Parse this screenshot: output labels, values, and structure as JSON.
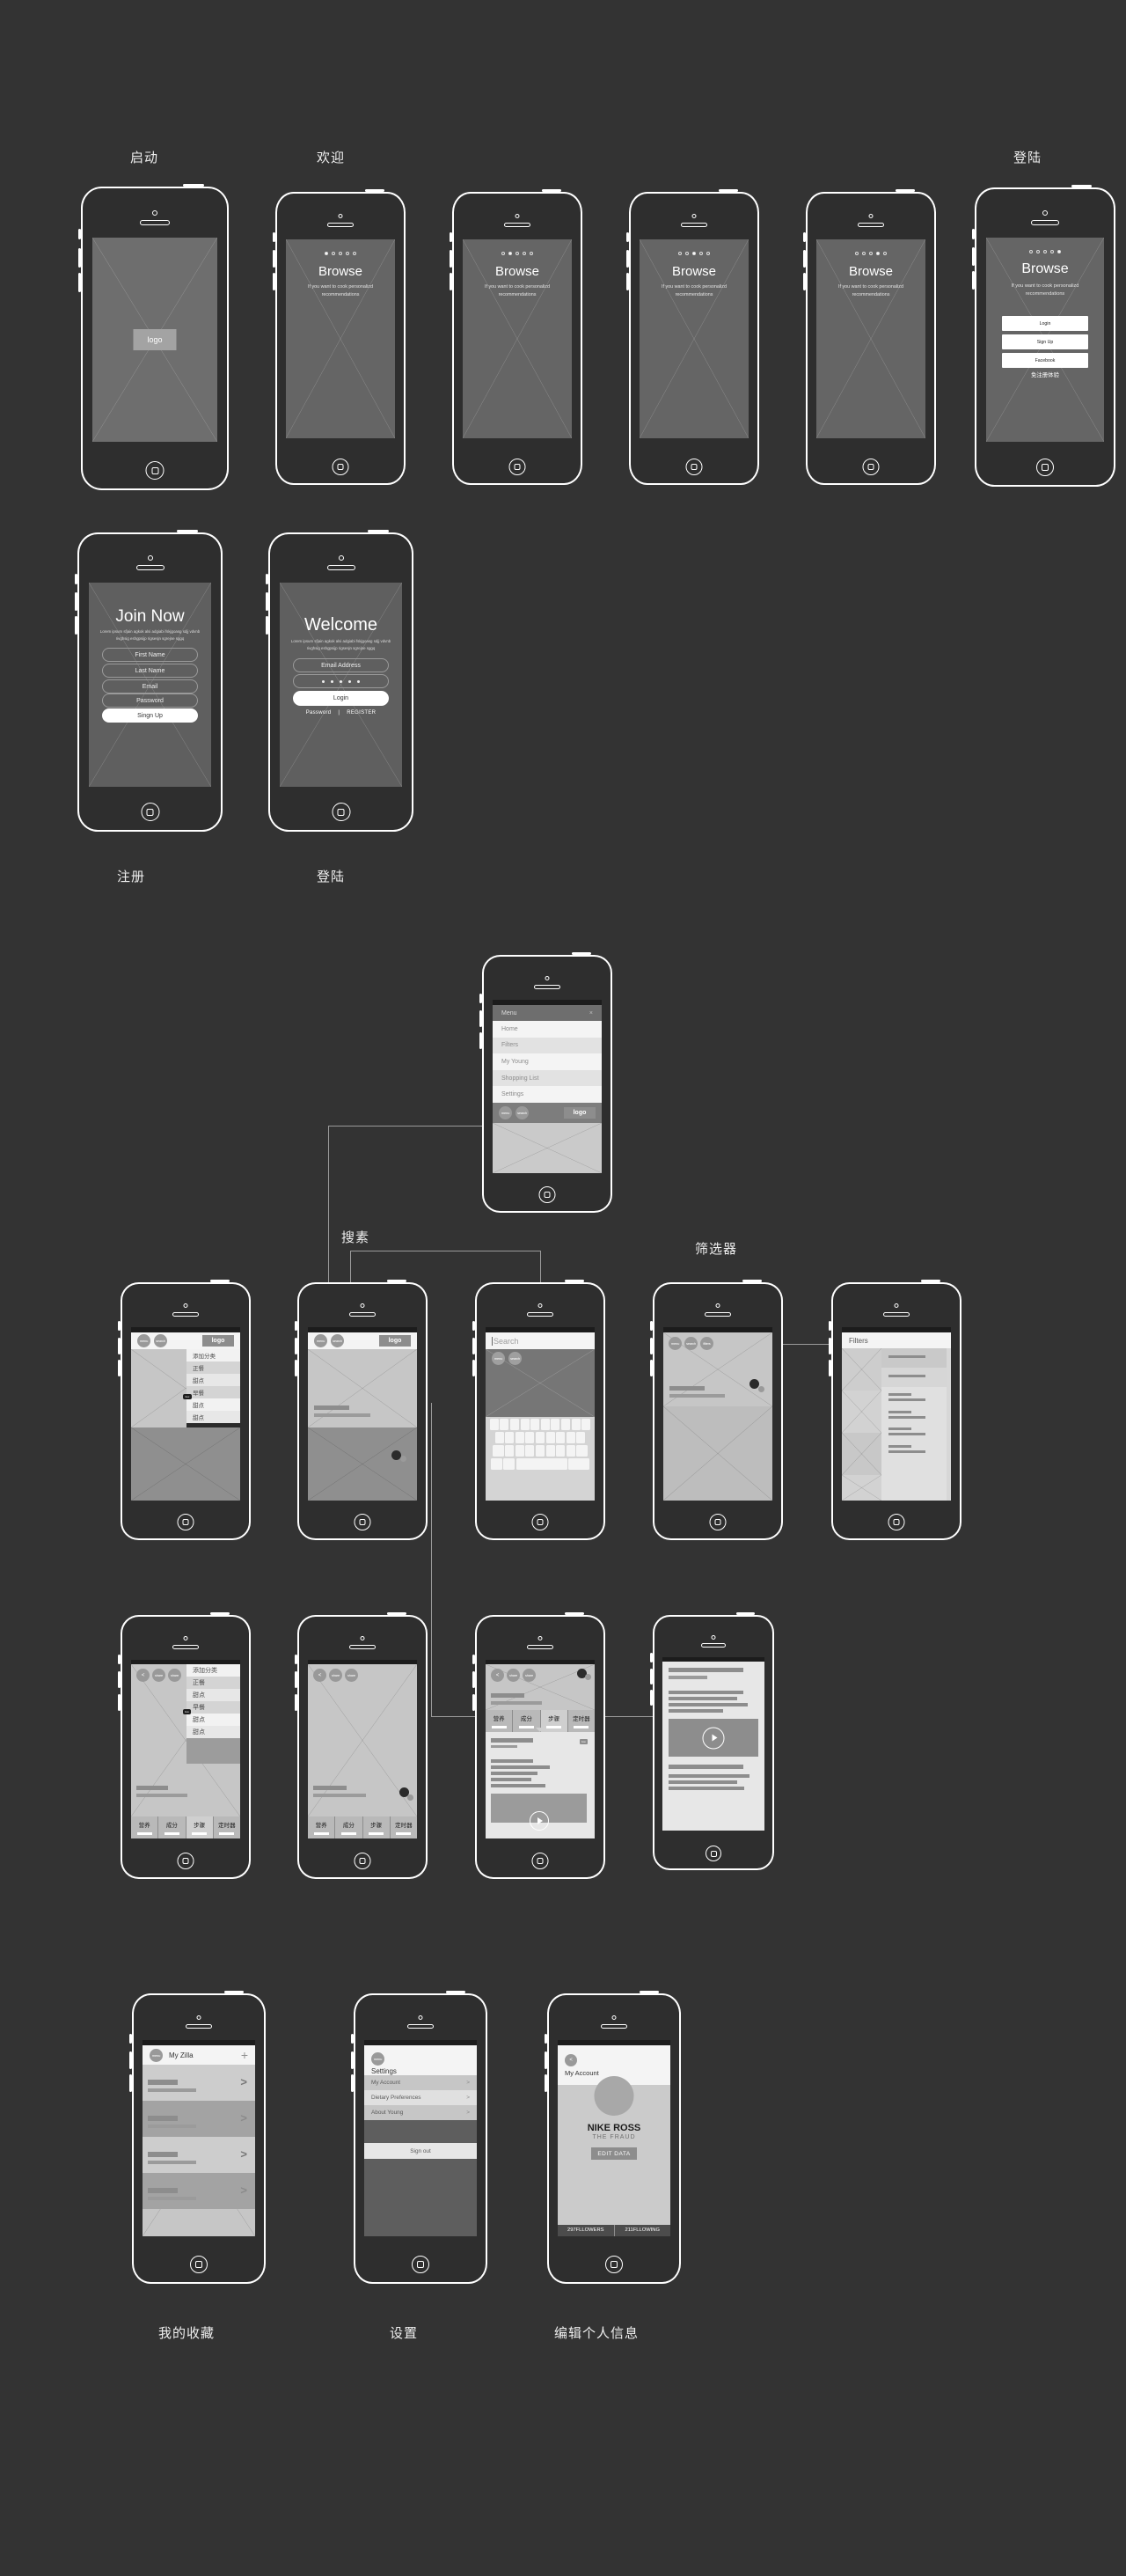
{
  "meta": {
    "bg_color": "#333333",
    "accent": "#ffffff"
  },
  "section_labels": {
    "launch": "启动",
    "welcome": "欢迎",
    "login_top": "登陆",
    "register": "注册",
    "login_bottom": "登陆",
    "search": "搜素",
    "filters": "筛选器",
    "favorites": "我的收藏",
    "settings": "设置",
    "edit_profile": "编辑个人信息"
  },
  "splash": {
    "logo_label": "logo"
  },
  "onboarding": {
    "title": "Browse",
    "subtitle": "If you want to cook personalizd recommendations",
    "dot_count": 5,
    "slides": [
      {
        "active_dot": 0
      },
      {
        "active_dot": 1
      },
      {
        "active_dot": 2
      },
      {
        "active_dot": 3
      },
      {
        "active_dot": 4
      }
    ],
    "buttons": [
      "Login",
      "Sign Up",
      "Facebook"
    ],
    "free_trial": "免注册体验"
  },
  "signup": {
    "title": "Join Now",
    "subtitle": "Lorem ipsum sfjain agkok alsi adgiabi fskjgoasg sdjj vdvnb rivghsig eshgpsijp rigsesjn sgrejne sggq",
    "fields": [
      "First Name",
      "Last Name",
      "Email",
      "Password"
    ],
    "submit": "Singn Up"
  },
  "login": {
    "title": "Welcome",
    "subtitle": "Lorem ipsum sfjain agkok alsi adgiabi fskjgoasg sdjj vdvnb rivghsig eshgpsijp rigsesjn sgrejne sggq",
    "email_placeholder": "Email Address",
    "password_dots": 5,
    "submit": "Login",
    "link_password": "Password",
    "link_separator": "|",
    "link_register": "REGISTER"
  },
  "menu_screen": {
    "header": "Menu",
    "close": "×",
    "items": [
      "Home",
      "Filters",
      "My Young",
      "Shopping List",
      "Settings"
    ],
    "toolbar": {
      "menu": "menu",
      "search": "search",
      "logo": "logo"
    }
  },
  "home_screen": {
    "toolbar": {
      "menu": "menu",
      "search": "search",
      "logo": "logo"
    },
    "dropdown": {
      "header": "添加分类",
      "items": [
        "正餐",
        "甜点",
        "早餐",
        "甜点",
        "甜点"
      ],
      "tag": "box"
    }
  },
  "search_screen": {
    "placeholder": "Search",
    "toolbar": {
      "menu": "menu",
      "search": "search"
    },
    "keyboard_rows": [
      10,
      9,
      9,
      3
    ]
  },
  "feed_screen": {
    "toolbar": {
      "menu": "menu",
      "search": "search",
      "filters": "filters"
    }
  },
  "filters_screen": {
    "title": "Filters"
  },
  "recipe_screen": {
    "toolbar": {
      "back": "<",
      "share1": "share",
      "share2": "share"
    },
    "tabs": [
      "营养",
      "成分",
      "步骤",
      "定时器"
    ],
    "selected_tab": 2,
    "dropdown": {
      "header": "添加分类",
      "items": [
        "正餐",
        "甜点",
        "早餐",
        "甜点",
        "甜点"
      ]
    },
    "tag": "box"
  },
  "favorites_screen": {
    "toolbar": {
      "menu": "menu"
    },
    "title": "My Zilla",
    "add": "+",
    "rows": 4,
    "chevron": ">"
  },
  "settings_screen": {
    "toolbar": {
      "menu": "menu"
    },
    "title": "Settings",
    "items": [
      "My Account",
      "Dietary Preferences",
      "About Young"
    ],
    "chevron": ">",
    "sign_out": "Sign out"
  },
  "account_screen": {
    "back": "<",
    "title": "My Account",
    "name": "NIKE ROSS",
    "handle": "THE FRAUD",
    "edit_button": "EDIT DATA",
    "stats": [
      "297FLLOWERS",
      "211FLLOWING"
    ]
  }
}
